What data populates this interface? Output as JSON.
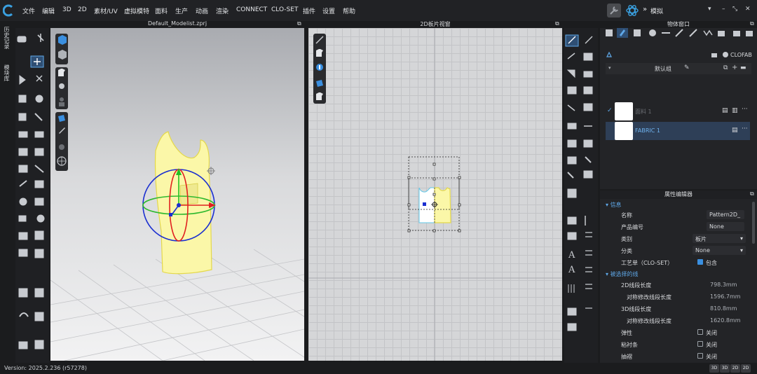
{
  "menu": [
    "文件",
    "编辑",
    "3D",
    "2D",
    "素材/UV",
    "虚拟模特",
    "面料",
    "生产",
    "动画",
    "渲染",
    "CONNECT",
    "CLO-SET",
    "插件",
    "设置",
    "帮助"
  ],
  "mode_label": "模拟",
  "window_controls": [
    "▾",
    "–",
    "⤡",
    "✕"
  ],
  "vertical_tabs": [
    "历史记录",
    "模块库"
  ],
  "viewport3d": {
    "title": "Default_Modelist.zprj"
  },
  "viewport2d": {
    "title": "2D板片视窗"
  },
  "object_window": {
    "title": "物体窗口",
    "brand": "CLOFAB",
    "group_label": "默认组",
    "fabrics": [
      {
        "name": "面料 1",
        "selected": false,
        "checked": true
      },
      {
        "name": "FABRIC 1",
        "selected": true,
        "checked": false
      }
    ]
  },
  "property_editor": {
    "title": "属性编辑器",
    "sections": {
      "info": "信息",
      "selected_lines": "被选择的线"
    },
    "fields": {
      "name_label": "名称",
      "name_value": "Pattern2D_",
      "product_code_label": "产品编号",
      "product_code_value": "None",
      "category_label": "类别",
      "category_value": "板片",
      "classification_label": "分类",
      "classification_value": "None",
      "techpack_label": "工艺单（CLO-SET）",
      "techpack_value": "包含",
      "len2d_label": "2D线段长度",
      "len2d_value": "798.3mm",
      "sym2d_label": "对称修改线段长度",
      "sym2d_value": "1596.7mm",
      "len3d_label": "3D线段长度",
      "len3d_value": "810.8mm",
      "sym3d_label": "对称修改线段长度",
      "sym3d_value": "1620.8mm",
      "elastic_label": "弹性",
      "elastic_value": "关闭",
      "tape_label": "粘衬条",
      "tape_value": "关闭",
      "shirring_label": "抽褶",
      "shirring_value": "关闭"
    }
  },
  "status": {
    "version": "Version: 2025.2.236 (r57278)",
    "view_buttons": [
      "3D",
      "3D",
      "2D",
      "2D"
    ]
  },
  "colors": {
    "accent": "#5fa8e8",
    "selected_row": "#2e3f57",
    "garment": "#fbf7a8"
  }
}
